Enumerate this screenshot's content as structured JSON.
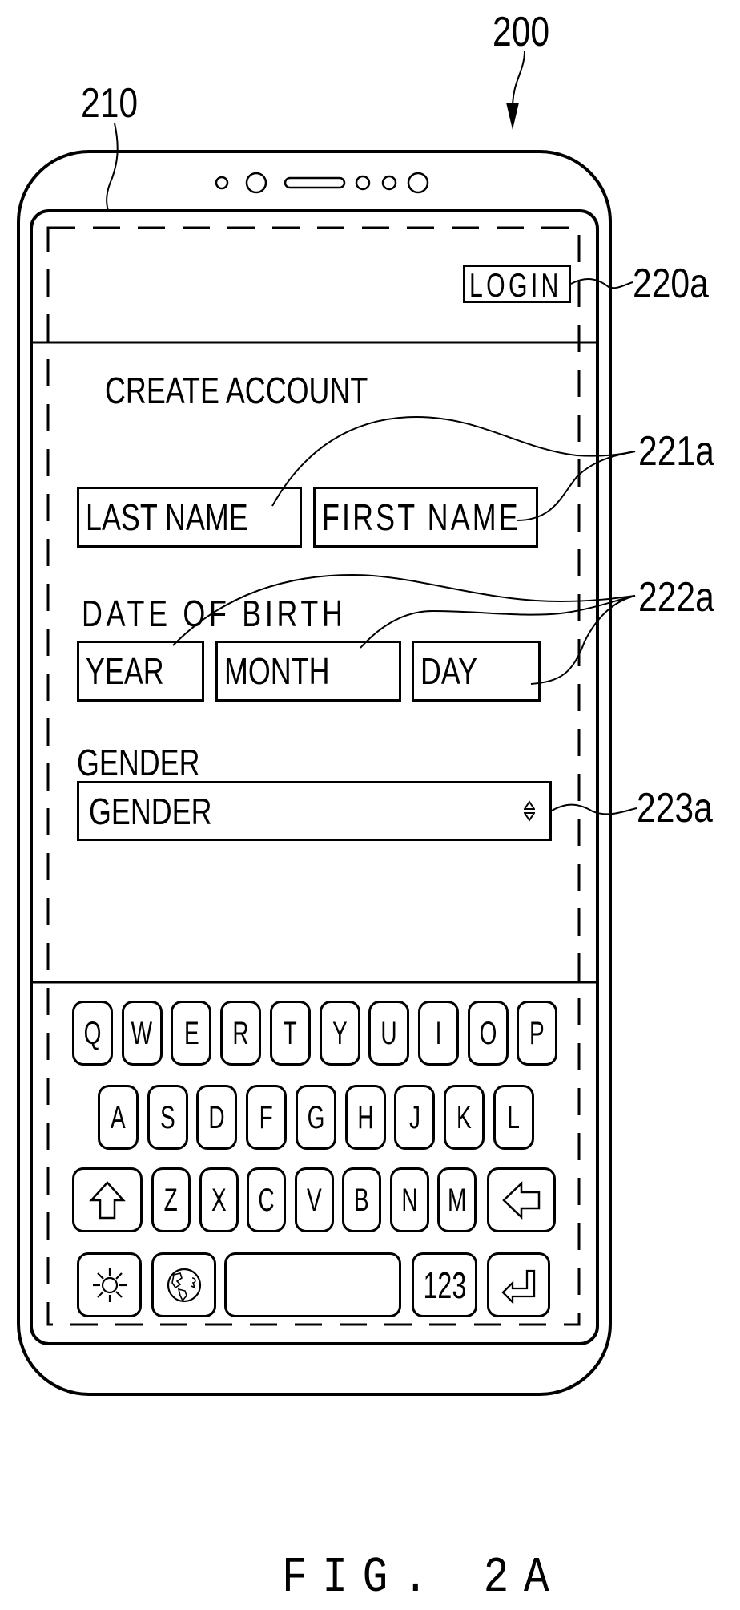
{
  "figure": {
    "caption": "FIG. 2A",
    "reference_numerals": {
      "device": "200",
      "display": "210",
      "login_button": "220a",
      "name_fields": "221a",
      "birth_fields": "222a",
      "gender_select": "223a"
    }
  },
  "device": {
    "sensors": [
      "small-sensor",
      "camera",
      "speaker",
      "small-sensor",
      "small-sensor",
      "camera"
    ]
  },
  "header": {
    "login_label": "LOGIN"
  },
  "form": {
    "title": "CREATE ACCOUNT",
    "name_fields": {
      "last_name_placeholder": "LAST NAME",
      "first_name_placeholder": "FIRST NAME"
    },
    "date_of_birth": {
      "label": "DATE OF BIRTH",
      "year_placeholder": "YEAR",
      "month_placeholder": "MONTH",
      "day_placeholder": "DAY"
    },
    "gender": {
      "label": "GENDER",
      "selected": "GENDER",
      "icon": "sort-updown-icon"
    }
  },
  "keyboard": {
    "row1": [
      "Q",
      "W",
      "E",
      "R",
      "T",
      "Y",
      "U",
      "I",
      "O",
      "P"
    ],
    "row2": [
      "A",
      "S",
      "D",
      "F",
      "G",
      "H",
      "J",
      "K",
      "L"
    ],
    "row3": [
      "Z",
      "X",
      "C",
      "V",
      "B",
      "N",
      "M"
    ],
    "row3_icons": {
      "left": "shift-icon",
      "right": "backspace-icon"
    },
    "row4": {
      "settings_icon": "sun-icon",
      "language_icon": "globe-icon",
      "space_label": "",
      "numbers_label": "123",
      "enter_icon": "enter-icon"
    }
  }
}
